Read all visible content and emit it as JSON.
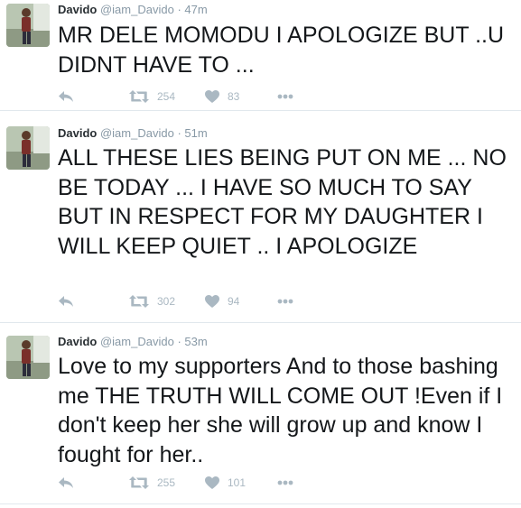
{
  "tweets": [
    {
      "fullname": "Davido",
      "username": "@iam_Davido",
      "separator": "·",
      "time": "47m",
      "text": "MR DELE MOMODU I APOLOGIZE BUT ..U DIDNT HAVE TO ...",
      "retweets": "254",
      "likes": "83",
      "icons": {
        "reply": "reply-icon",
        "retweet": "retweet-icon",
        "like": "heart-icon",
        "more": "more-icon"
      }
    },
    {
      "fullname": "Davido",
      "username": "@iam_Davido",
      "separator": "·",
      "time": "51m",
      "text": "ALL THESE LIES BEING PUT ON ME ... NO BE TODAY ... I HAVE SO MUCH TO SAY BUT IN RESPECT FOR MY DAUGHTER I WILL KEEP QUIET .. I APOLOGIZE",
      "retweets": "302",
      "likes": "94",
      "icons": {
        "reply": "reply-icon",
        "retweet": "retweet-icon",
        "like": "heart-icon",
        "more": "more-icon"
      }
    },
    {
      "fullname": "Davido",
      "username": "@iam_Davido",
      "separator": "·",
      "time": "53m",
      "text": "Love to my supporters And to those bashing me THE TRUTH WILL COME OUT !Even if I don't keep her she will grow up and know I fought for her..",
      "retweets": "255",
      "likes": "101",
      "icons": {
        "reply": "reply-icon",
        "retweet": "retweet-icon",
        "like": "heart-icon",
        "more": "more-icon"
      }
    }
  ],
  "colors": {
    "name": "#292f33",
    "meta": "#8899a6",
    "text": "#14171a",
    "action": "#aab8c2",
    "divider": "#e1e8ed"
  }
}
